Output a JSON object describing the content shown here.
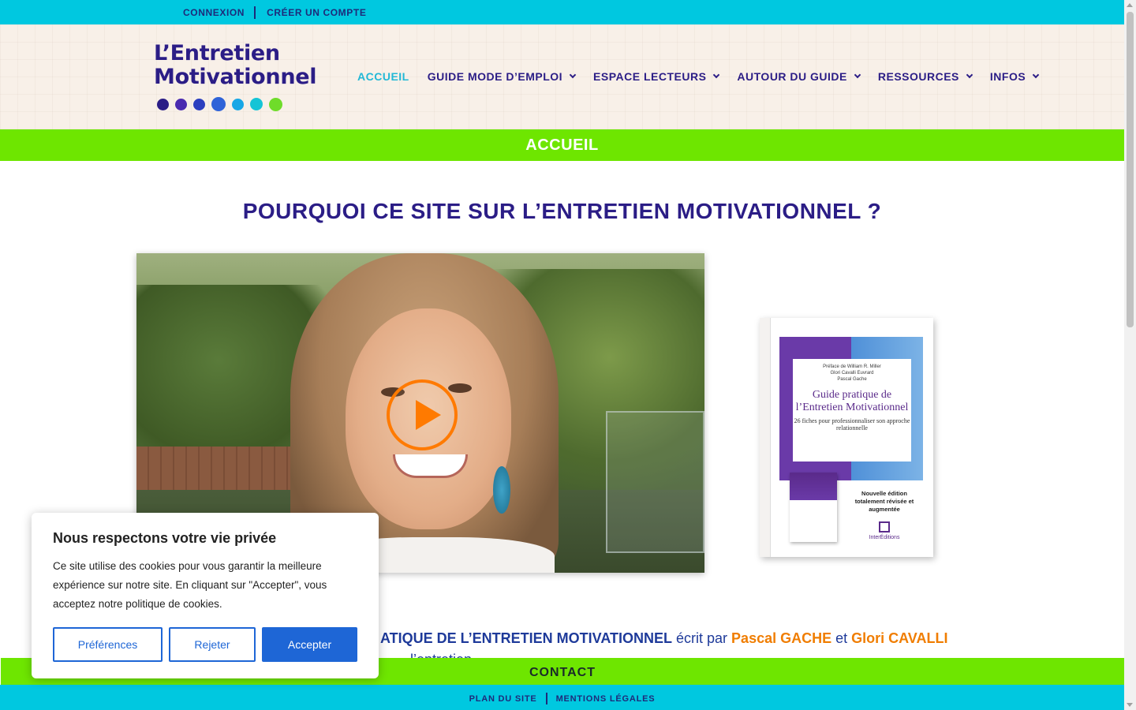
{
  "topbar": {
    "login": "CONNEXION",
    "signup": "CRÉER UN COMPTE"
  },
  "logo": {
    "line1": "L’Entretien",
    "line2": "Motivationnel",
    "dot_colors": [
      "#2b1d86",
      "#4a2bb0",
      "#2c3fbf",
      "#2f63d8",
      "#18a7e6",
      "#15c4d6",
      "#6fdc2a"
    ]
  },
  "nav": {
    "items": [
      {
        "label": "ACCUEIL",
        "active": true,
        "dropdown": false
      },
      {
        "label": "GUIDE MODE D’EMPLOI",
        "active": false,
        "dropdown": true
      },
      {
        "label": "ESPACE LECTEURS",
        "active": false,
        "dropdown": true
      },
      {
        "label": "AUTOUR DU GUIDE",
        "active": false,
        "dropdown": true
      },
      {
        "label": "RESSOURCES",
        "active": false,
        "dropdown": true
      },
      {
        "label": "INFOS",
        "active": false,
        "dropdown": true
      }
    ]
  },
  "page_banner": "ACCUEIL",
  "main_title": "POURQUOI CE SITE SUR L’ENTRETIEN MOTIVATIONNEL ?",
  "book": {
    "preface": "Préface de William R. Miller",
    "authors1": "Glori Cavalli Euvrard",
    "authors2": "Pascal Gache",
    "title": "Guide pratique de l’Entretien Motivationnel",
    "subtitle": "26 fiches pour professionnaliser son approche relationnelle",
    "edition": "Nouvelle édition totalement révisée et augmentée",
    "publisher": "InterÉditions"
  },
  "intro": {
    "part1": "ATIQUE DE L’ENTRETIEN MOTIVATIONNEL",
    "part2": " écrit par ",
    "author1": "Pascal GACHE",
    "part3": " et ",
    "author2": "Glori CAVALLI",
    "line2": "l’entretien"
  },
  "contact": "CONTACT",
  "footer": {
    "sitemap": "PLAN DU SITE",
    "legal": "MENTIONS LÉGALES"
  },
  "cookie": {
    "title": "Nous respectons votre vie privée",
    "body": "Ce site utilise des cookies pour vous garantir la meilleure expérience sur notre site. En cliquant sur  \"Accepter\", vous acceptez notre politique de cookies.",
    "preferences": "Préférences",
    "reject": "Rejeter",
    "accept": "Accepter"
  },
  "colors": {
    "accent": "#22b8d6",
    "brand_purple": "#2b1d86",
    "green": "#6ee600",
    "cyan": "#00c8e0",
    "orange": "#f07d00",
    "button_blue": "#1e66d6"
  }
}
